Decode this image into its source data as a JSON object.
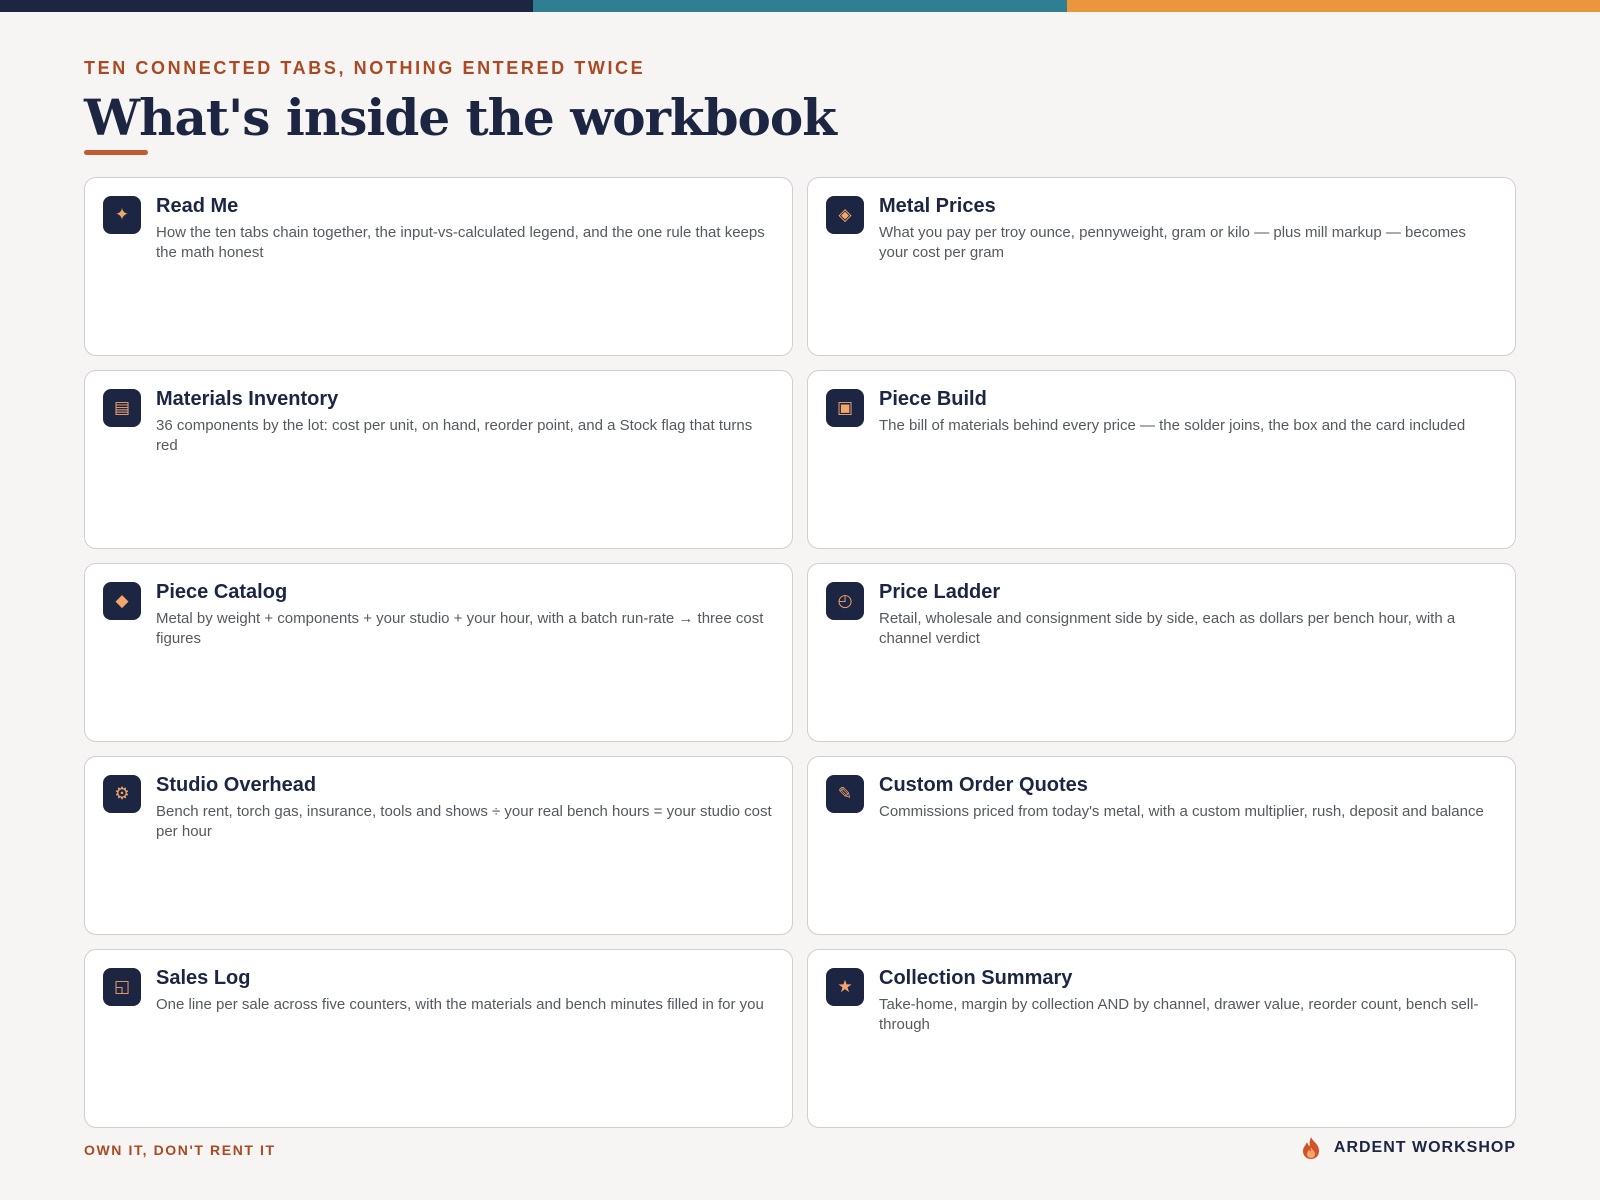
{
  "header": {
    "eyebrow": "TEN CONNECTED TABS, NOTHING ENTERED TWICE",
    "title": "What's inside the workbook"
  },
  "cards": [
    {
      "title": "Read Me",
      "description": "How the ten tabs chain together, the input-vs-calculated legend, and the one rule that keeps the math honest",
      "icon": "sparkle-icon",
      "glyph": "✦"
    },
    {
      "title": "Metal Prices",
      "description": "What you pay per troy ounce, pennyweight, gram or kilo — plus mill markup — becomes your cost per gram",
      "icon": "diamond-outline-icon",
      "glyph": "◈"
    },
    {
      "title": "Materials Inventory",
      "description": "36 components by the lot: cost per unit, on hand, reorder point, and a Stock flag that turns red",
      "icon": "list-icon",
      "glyph": "▤"
    },
    {
      "title": "Piece Build",
      "description": "The bill of materials behind every price — the solder joins, the box and the card included",
      "icon": "gift-box-icon",
      "glyph": "▣"
    },
    {
      "title": "Piece Catalog",
      "description": "Metal by weight + components + your studio + your hour, with a batch run-rate → three cost figures",
      "icon": "diamond-icon",
      "glyph": "◆"
    },
    {
      "title": "Price Ladder",
      "description": "Retail, wholesale and consignment side by side, each as dollars per bench hour, with a channel verdict",
      "icon": "clock-icon",
      "glyph": "◴"
    },
    {
      "title": "Studio Overhead",
      "description": "Bench rent, torch gas, insurance, tools and shows ÷ your real bench hours = your studio cost per hour",
      "icon": "gear-icon",
      "glyph": "⚙"
    },
    {
      "title": "Custom Order Quotes",
      "description": "Commissions priced from today's metal, with a custom multiplier, rush, deposit and balance",
      "icon": "pencil-icon",
      "glyph": "✎"
    },
    {
      "title": "Sales Log",
      "description": "One line per sale across five counters, with the materials and bench minutes filled in for you",
      "icon": "ledger-icon",
      "glyph": "◱"
    },
    {
      "title": "Collection Summary",
      "description": "Take-home, margin by collection AND by channel, drawer value, reorder count, bench sell-through",
      "icon": "star-icon",
      "glyph": "★"
    }
  ],
  "footer": {
    "tagline": "OWN IT, DON'T RENT IT",
    "brand": "ARDENT WORKSHOP",
    "brand_icon": "flame-icon"
  },
  "colors": {
    "navy": "#1c2541",
    "teal": "#2f7f93",
    "orange": "#e9963d",
    "accent_red": "#a94a24",
    "background": "#f6f5f3"
  }
}
